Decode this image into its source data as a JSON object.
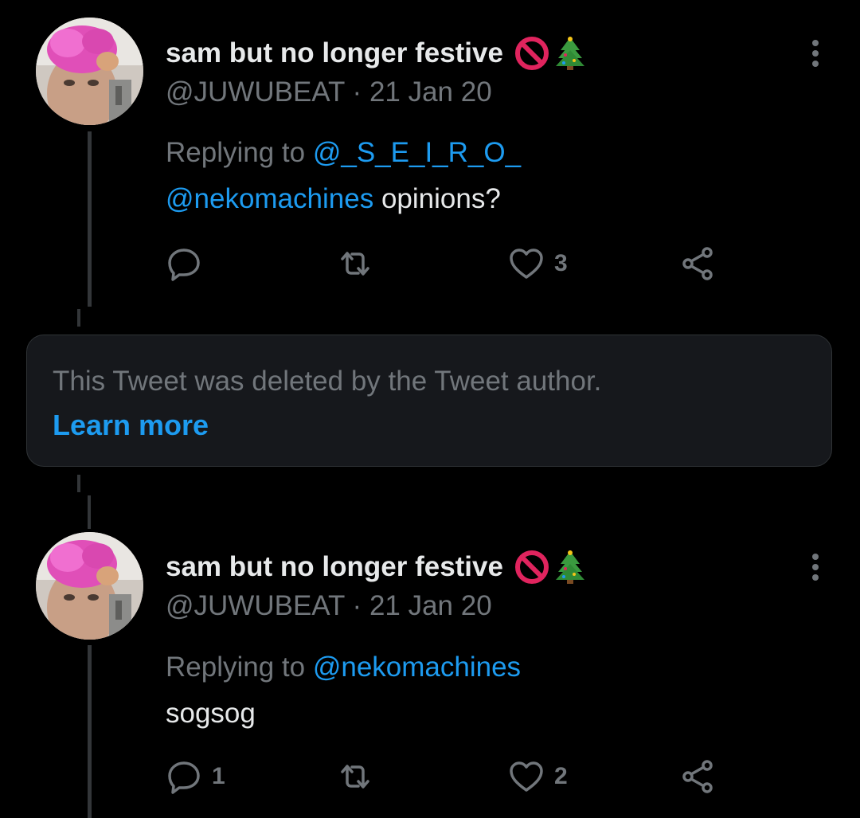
{
  "tweets": [
    {
      "display_name": "sam but no longer festive",
      "name_emojis": [
        "no-entry-icon",
        "christmas-tree-icon"
      ],
      "handle": "@JUWUBEAT",
      "separator": "·",
      "date": "21 Jan 20",
      "replying_prefix": "Replying to",
      "replying_to": "@_S_E_I_R_O_",
      "body_mention": "@nekomachines",
      "body_text": " opinions?",
      "reply_count": "",
      "like_count": "3"
    },
    {
      "display_name": "sam but no longer festive",
      "name_emojis": [
        "no-entry-icon",
        "christmas-tree-icon"
      ],
      "handle": "@JUWUBEAT",
      "separator": "·",
      "date": "21 Jan 20",
      "replying_prefix": "Replying to",
      "replying_to": "@nekomachines",
      "body_mention": "",
      "body_text": "sogsog",
      "reply_count": "1",
      "like_count": "2"
    }
  ],
  "deleted_notice": {
    "text": "This Tweet was deleted by the Tweet author.",
    "link": "Learn more"
  },
  "colors": {
    "background": "#000000",
    "text_primary": "#e7e9ea",
    "text_secondary": "#71767b",
    "accent": "#1d9bf0",
    "card_bg": "#16181c"
  }
}
